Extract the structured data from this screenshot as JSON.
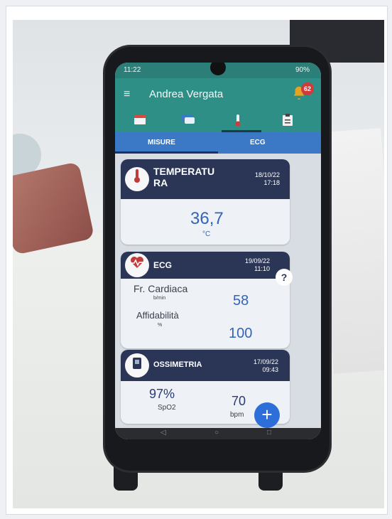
{
  "status_bar": {
    "time": "11:22",
    "battery": "90%"
  },
  "app_bar": {
    "menu_glyph": "≡",
    "user_name": "Andrea Vergata",
    "notification_count": "62"
  },
  "tabs": [
    {
      "label": "MISURE"
    },
    {
      "label": "ECG"
    }
  ],
  "temperature_card": {
    "name_line1": "TEMPERATU",
    "name_line2": "RA",
    "date": "18/10/22",
    "time": "17:18",
    "value": "36,7",
    "unit": "°C"
  },
  "ecg_card": {
    "name": "ECG",
    "date": "19/09/22",
    "time": "11:10",
    "help": "?",
    "heart_rate_label": "Fr. Cardiaca",
    "heart_rate_unit": "b/min",
    "heart_rate_value": "58",
    "reliability_label": "Affidabilità",
    "reliability_unit": "%",
    "reliability_value": "100"
  },
  "oximetry_card": {
    "name": "OSSIMETRIA",
    "date": "17/09/22",
    "time": "09:43",
    "spo2_value": "97%",
    "spo2_label": "SpO2",
    "bpm_value": "70",
    "bpm_label": "bpm"
  },
  "fab": {
    "glyph": "+"
  },
  "colors": {
    "teal": "#2e8f86",
    "tab_blue": "#3b78c6",
    "card_header": "#2b3656",
    "value_blue": "#3464b7",
    "bell": "#e4a321",
    "badge": "#d23a3a"
  }
}
